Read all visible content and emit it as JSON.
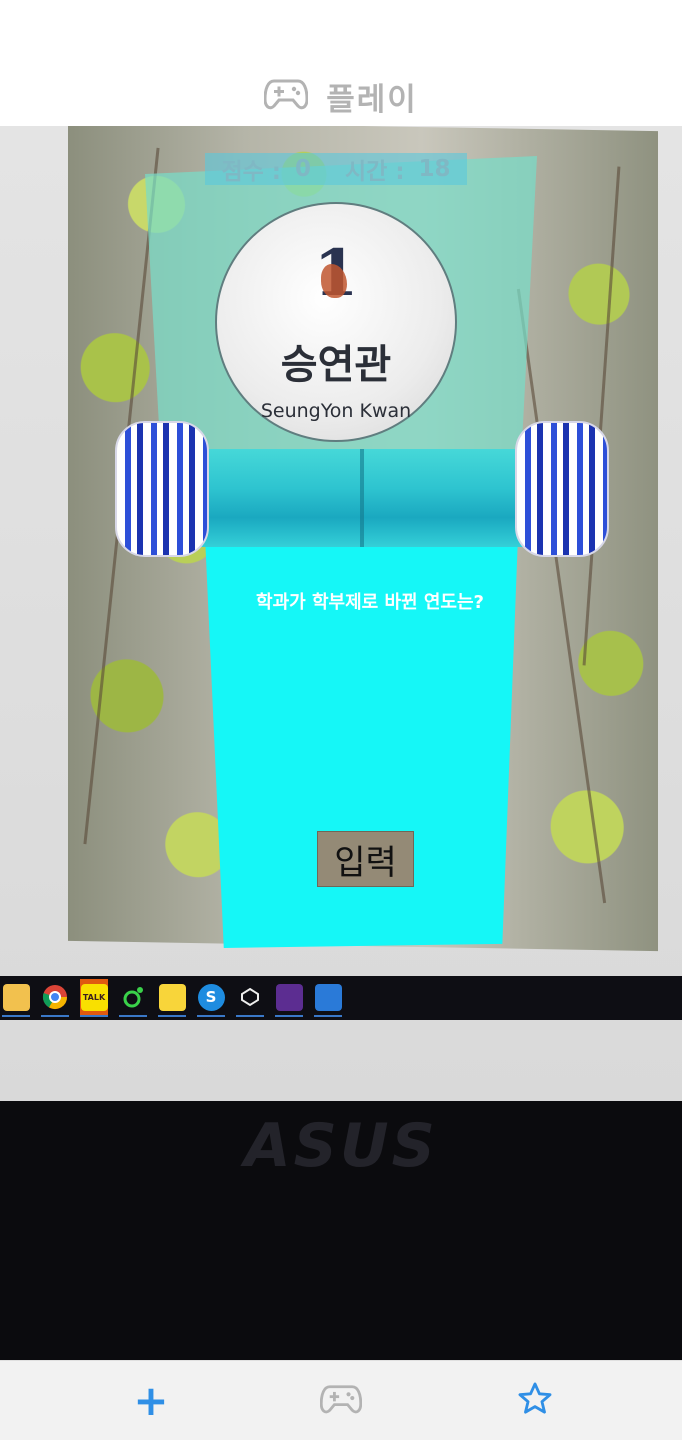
{
  "header": {
    "title": "플레이",
    "icon": "gamepad-icon"
  },
  "game": {
    "hud": {
      "score_label": "점수 :",
      "score_value": "0",
      "time_label": "시간 :",
      "time_value": "18"
    },
    "sign": {
      "number": "1",
      "name_ko": "승연관",
      "name_en": "SeungYon Kwan"
    },
    "question": "학과가 학부제로 바뀐 연도는?",
    "input_button_label": "입력"
  },
  "taskbar": {
    "icons": [
      "file-explorer-icon",
      "chrome-icon",
      "kakaotalk-icon",
      "app-icon",
      "sticky-notes-icon",
      "skype-icon",
      "unity-icon",
      "visual-studio-icon",
      "photos-icon"
    ],
    "kakao_label": "TALK",
    "skype_label": "S"
  },
  "device_brand": "ASUS",
  "bottom_nav": {
    "items": [
      {
        "name": "add",
        "icon": "plus-icon",
        "color": "#2f8fe6"
      },
      {
        "name": "play",
        "icon": "gamepad-icon",
        "color": "#b3b3b3"
      },
      {
        "name": "favorites",
        "icon": "star-icon",
        "color": "#2f8fe6"
      }
    ]
  }
}
